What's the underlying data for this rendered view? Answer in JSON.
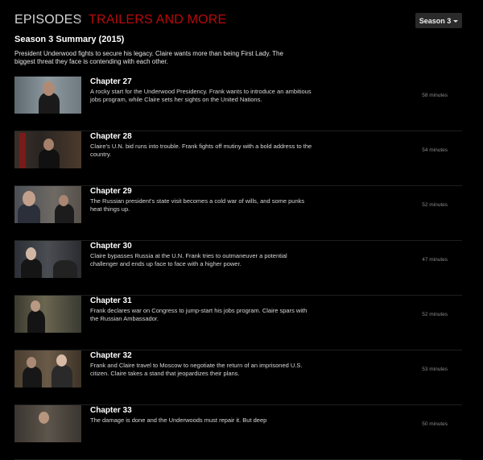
{
  "tabs": {
    "episodes": "EPISODES",
    "separator": "/",
    "trailers": "TRAILERS AND MORE"
  },
  "season_select": {
    "selected": "Season 3"
  },
  "summary": {
    "title": "Season 3 Summary (2015)",
    "text": "President Underwood fights to secure his legacy. Claire wants more than being First Lady. The biggest threat they face is contending with each other."
  },
  "episodes": [
    {
      "title": "Chapter 27",
      "description": "A rocky start for the Underwood Presidency. Frank wants to introduce an ambitious jobs program, while Claire sets her sights on the United Nations.",
      "duration": "58 minutes"
    },
    {
      "title": "Chapter 28",
      "description": "Claire's U.N. bid runs into trouble. Frank fights off mutiny with a bold address to the country.",
      "duration": "54 minutes"
    },
    {
      "title": "Chapter 29",
      "description": "The Russian president's state visit becomes a cold war of wills, and some punks heat things up.",
      "duration": "52 minutes"
    },
    {
      "title": "Chapter 30",
      "description": "Claire bypasses Russia at the U.N. Frank tries to outmaneuver a potential challenger and ends up face to face with a higher power.",
      "duration": "47 minutes"
    },
    {
      "title": "Chapter 31",
      "description": "Frank declares war on Congress to jump-start his jobs program. Claire spars with the Russian Ambassador.",
      "duration": "52 minutes"
    },
    {
      "title": "Chapter 32",
      "description": "Frank and Claire travel to Moscow to negotiate the return of an imprisoned U.S. citizen. Claire takes a stand that jeopardizes their plans.",
      "duration": "53 minutes"
    },
    {
      "title": "Chapter 33",
      "description": "The damage is done and the Underwoods must repair it. But deep",
      "duration": "50 minutes"
    }
  ],
  "colors": {
    "accent_red": "#b9090b",
    "background": "#000000"
  }
}
